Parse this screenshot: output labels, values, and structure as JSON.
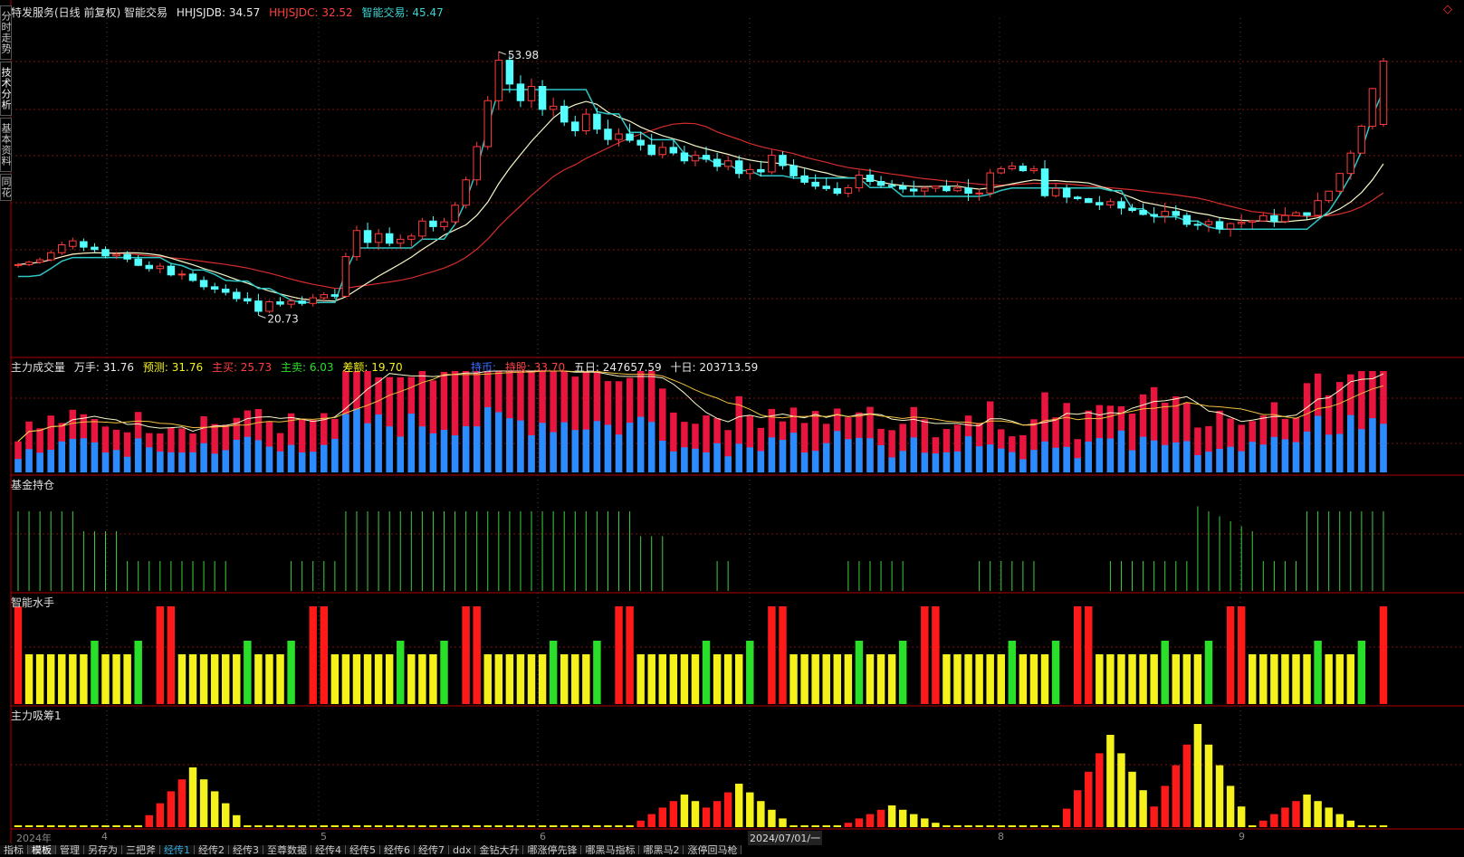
{
  "colors": {
    "up": "#ff3b3b",
    "down": "#54ffff",
    "line_ma1": "#f6f6c8",
    "line_ma2": "#d72c2c",
    "trail": "#2fc6c6",
    "grid": "#7a1212",
    "axis": "#b00000",
    "vol_red": "#e8153f",
    "vol_blue": "#2a8cff",
    "fund": "#3fd13f",
    "yellow": "#f4f21a",
    "green": "#2adf2a",
    "red": "#ff1a1a"
  },
  "main": {
    "title": "特发服务(日线 前复权) 智能交易",
    "i1_label": "HHJSJDB: 34.57",
    "i1_color": "#e8e8e8",
    "i2_label": "HHJSJDC: 32.52",
    "i2_color": "#ff4040",
    "i3_label": "智能交易: 45.47",
    "i3_color": "#39d4d4",
    "high_label": "53.98",
    "low_label": "20.73",
    "arrow": "◇"
  },
  "vol": {
    "title": "主力成交量",
    "l1": "万手: 31.76",
    "l2": "预测: 31.76",
    "l3": "主买: 25.73",
    "l4": "主卖: 6.03",
    "l5": "差额: 19.70",
    "l6": "持币:",
    "l7": "持股: 33.70",
    "l8": "五日: 247657.59",
    "l9": "十日: 203713.59"
  },
  "fund_panel": {
    "title": "基金持仓"
  },
  "smart_panel": {
    "title": "智能水手"
  },
  "absorb_panel": {
    "title": "主力吸筹1"
  },
  "side_tabs": [
    "分时走势",
    "技术分析",
    "基本资料",
    "同花"
  ],
  "dates": [
    "2024年",
    "4",
    "5",
    "6",
    "2024/07/01/一",
    "8",
    "9"
  ],
  "tabs": [
    "指标",
    "模板",
    "管理",
    "另存为",
    "三把斧",
    "经传1",
    "经传2",
    "经传3",
    "至尊数据",
    "经传4",
    "经传5",
    "经传6",
    "经传7",
    "ddx",
    "金钻大升",
    "哪涨停先锋",
    "哪黑马指标",
    "哪黑马2",
    "涨停回马枪"
  ],
  "active_tab": "模板",
  "chart_data": [
    {
      "type": "candlestick",
      "title": "特发服务(日线 前复权) 智能交易",
      "ylim": [
        18,
        58
      ],
      "annotations": [
        {
          "label": "53.98",
          "bar": 40
        },
        {
          "label": "20.73",
          "bar": 17
        }
      ],
      "series": [
        {
          "name": "HHJSJDB",
          "values": []
        },
        {
          "name": "HHJSJDC",
          "values": []
        },
        {
          "name": "智能交易",
          "values": []
        }
      ],
      "bars": [
        [
          27.0,
          27.3,
          26.7,
          27.1
        ],
        [
          27.1,
          27.6,
          26.9,
          27.4
        ],
        [
          27.4,
          28.0,
          27.2,
          27.7
        ],
        [
          27.7,
          28.9,
          27.5,
          28.6
        ],
        [
          28.6,
          30.0,
          28.3,
          29.6
        ],
        [
          29.4,
          30.5,
          29.0,
          30.1
        ],
        [
          30.0,
          30.4,
          28.8,
          29.3
        ],
        [
          29.3,
          29.8,
          28.5,
          29.0
        ],
        [
          29.0,
          29.4,
          27.9,
          28.2
        ],
        [
          28.2,
          28.7,
          27.8,
          28.4
        ],
        [
          28.4,
          28.8,
          27.4,
          27.8
        ],
        [
          27.8,
          28.3,
          26.9,
          27.0
        ],
        [
          27.0,
          27.5,
          26.2,
          26.6
        ],
        [
          26.6,
          27.3,
          26.0,
          26.9
        ],
        [
          26.9,
          27.2,
          25.6,
          25.8
        ],
        [
          25.8,
          26.4,
          25.2,
          25.9
        ],
        [
          25.9,
          26.3,
          24.9,
          25.1
        ],
        [
          25.1,
          25.6,
          23.9,
          24.3
        ],
        [
          24.3,
          24.8,
          23.5,
          24.0
        ],
        [
          24.0,
          24.6,
          23.2,
          23.6
        ],
        [
          23.6,
          24.1,
          22.4,
          22.8
        ],
        [
          22.8,
          23.6,
          22.1,
          22.5
        ],
        [
          22.5,
          23.4,
          20.7,
          21.2
        ],
        [
          21.2,
          22.6,
          21.0,
          22.4
        ],
        [
          22.4,
          23.0,
          21.8,
          22.1
        ],
        [
          22.1,
          22.8,
          21.6,
          22.5
        ],
        [
          22.5,
          23.1,
          21.9,
          22.2
        ],
        [
          22.2,
          23.4,
          21.8,
          22.9
        ],
        [
          22.9,
          23.6,
          22.4,
          23.3
        ],
        [
          23.3,
          24.0,
          22.8,
          23.1
        ],
        [
          23.1,
          28.6,
          23.0,
          28.1
        ],
        [
          28.1,
          32.0,
          27.6,
          31.4
        ],
        [
          31.4,
          32.4,
          29.2,
          29.9
        ],
        [
          29.9,
          31.6,
          29.0,
          31.0
        ],
        [
          31.0,
          31.8,
          29.4,
          29.8
        ],
        [
          29.8,
          30.9,
          29.1,
          30.3
        ],
        [
          30.3,
          31.0,
          29.4,
          30.7
        ],
        [
          30.7,
          33.0,
          30.2,
          32.6
        ],
        [
          32.6,
          33.2,
          31.3,
          31.9
        ],
        [
          31.9,
          33.0,
          31.4,
          32.5
        ],
        [
          32.5,
          35.0,
          32.1,
          34.6
        ],
        [
          34.6,
          38.2,
          34.2,
          37.8
        ],
        [
          37.8,
          42.6,
          37.1,
          42.0
        ],
        [
          42.0,
          48.4,
          41.6,
          47.8
        ],
        [
          47.8,
          53.98,
          46.6,
          52.9
        ],
        [
          52.9,
          53.5,
          48.8,
          49.9
        ],
        [
          49.9,
          51.0,
          47.0,
          47.8
        ],
        [
          47.8,
          50.6,
          46.9,
          49.6
        ],
        [
          49.6,
          50.4,
          45.9,
          46.7
        ],
        [
          46.7,
          48.2,
          45.8,
          47.1
        ],
        [
          47.1,
          47.9,
          44.6,
          45.1
        ],
        [
          45.1,
          45.9,
          43.3,
          44.0
        ],
        [
          44.0,
          46.8,
          43.5,
          46.1
        ],
        [
          46.1,
          46.9,
          43.6,
          44.2
        ],
        [
          44.2,
          45.4,
          42.2,
          42.9
        ],
        [
          42.9,
          44.3,
          42.0,
          43.6
        ],
        [
          43.6,
          44.9,
          42.5,
          42.8
        ],
        [
          42.8,
          43.9,
          41.5,
          42.2
        ],
        [
          42.2,
          43.6,
          40.8,
          41.0
        ],
        [
          41.0,
          42.6,
          40.5,
          41.9
        ],
        [
          41.9,
          42.8,
          40.9,
          41.2
        ],
        [
          41.2,
          42.1,
          39.8,
          40.2
        ],
        [
          40.2,
          41.5,
          39.5,
          40.9
        ],
        [
          40.9,
          42.0,
          40.0,
          40.4
        ],
        [
          40.4,
          41.2,
          38.9,
          39.5
        ],
        [
          39.5,
          40.8,
          39.0,
          40.2
        ],
        [
          40.2,
          40.9,
          38.0,
          38.6
        ],
        [
          38.6,
          39.8,
          37.8,
          39.1
        ],
        [
          39.1,
          40.2,
          38.2,
          38.8
        ],
        [
          38.8,
          41.6,
          38.5,
          40.9
        ],
        [
          40.9,
          41.4,
          39.1,
          39.6
        ],
        [
          39.6,
          40.4,
          37.9,
          38.3
        ],
        [
          38.3,
          39.2,
          37.2,
          37.5
        ],
        [
          37.5,
          38.5,
          36.6,
          37.0
        ],
        [
          37.0,
          38.1,
          36.4,
          36.7
        ],
        [
          36.7,
          37.5,
          35.8,
          36.1
        ],
        [
          36.1,
          37.2,
          35.6,
          36.8
        ],
        [
          36.8,
          39.0,
          36.3,
          38.4
        ],
        [
          38.4,
          39.2,
          37.1,
          37.6
        ],
        [
          37.6,
          38.3,
          36.8,
          37.1
        ]
      ]
    },
    {
      "type": "bar",
      "title": "主力成交量",
      "series": [
        {
          "name": "主买",
          "values": []
        },
        {
          "name": "主卖",
          "values": []
        },
        {
          "name": "五日",
          "values": []
        },
        {
          "name": "十日",
          "values": []
        }
      ]
    },
    {
      "type": "bar",
      "title": "基金持仓",
      "values": []
    },
    {
      "type": "bar",
      "title": "智能水手",
      "values": []
    },
    {
      "type": "bar",
      "title": "主力吸筹1",
      "values": []
    }
  ]
}
